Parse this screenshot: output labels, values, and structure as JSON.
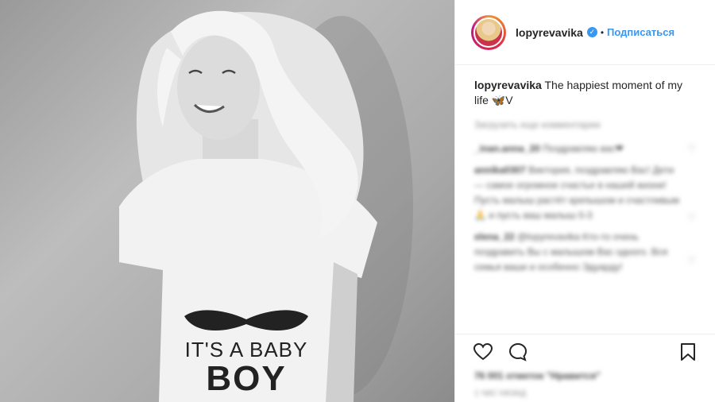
{
  "post": {
    "username": "lopyrevavika",
    "dot": "•",
    "follow_label": "Подписаться",
    "caption_user": "lopyrevavika",
    "caption_text": " The happiest moment of my life ",
    "caption_emoji": "🦋",
    "caption_tail": "V",
    "shirt_line1": "IT'S A BABY",
    "shirt_line2": "BOY",
    "load_more": "Загрузить еще комментарии",
    "comments": [
      {
        "user": "_inan.anna_20",
        "text": "Поздравляю вас❤"
      },
      {
        "user": "annika0307",
        "text": "Виктория, поздравляю Вас! Дети — самое огромное счастье в нашей жизни! Пусть малыш растёт крепышом и счастливым 🙏 и пусть ваш малыш 0-3"
      },
      {
        "user": "elena_22",
        "text": "@lopyrevavika Кто-то очень поздравить Вы с малышом Вас одного. Вся семья ваши и особенно Эдуарду!"
      }
    ],
    "likes": "76 001 отметок \"Нравится\"",
    "time": "1 ЧАС НАЗАД"
  },
  "icons": {
    "verified": "verified-badge-icon",
    "heart": "heart-icon",
    "comment": "comment-icon",
    "bookmark": "bookmark-icon"
  },
  "colors": {
    "link_blue": "#3897f0",
    "verified_blue": "#3897f0",
    "divider": "#efefef"
  }
}
